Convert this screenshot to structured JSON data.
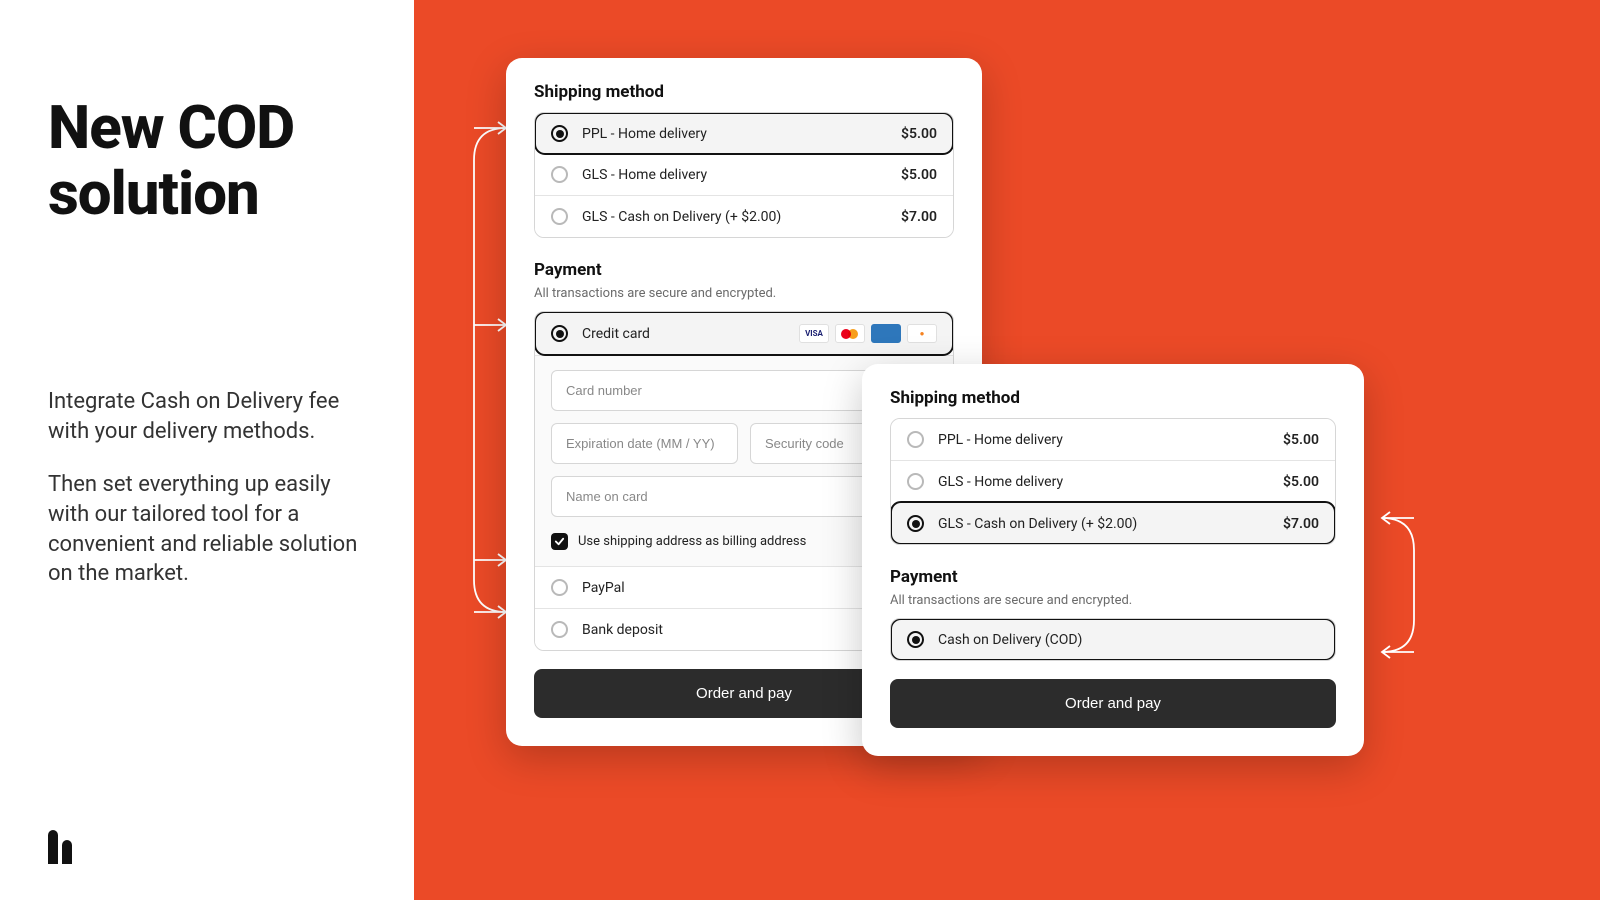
{
  "left": {
    "headline": "New COD solution",
    "p1": "Integrate Cash on Delivery fee with your delivery methods.",
    "p2": "Then set everything up easily with our tailored tool for a convenient and reliable solution on the market."
  },
  "card_big": {
    "shipping_title": "Shipping method",
    "shipping_options": [
      {
        "label": "PPL - Home delivery",
        "price": "$5.00",
        "selected": true
      },
      {
        "label": "GLS - Home delivery",
        "price": "$5.00",
        "selected": false
      },
      {
        "label": "GLS - Cash on Delivery (+ $2.00)",
        "price": "$7.00",
        "selected": false
      }
    ],
    "payment_title": "Payment",
    "payment_sub": "All transactions are secure and encrypted.",
    "cc_label": "Credit card",
    "cc_fields": {
      "card_number": "Card number",
      "exp": "Expiration date (MM / YY)",
      "cvc": "Security code",
      "name": "Name on card"
    },
    "billing_checkbox_label": "Use shipping address as billing address",
    "paypal_label": "PayPal",
    "bank_label": "Bank deposit",
    "cta": "Order and pay"
  },
  "card_small": {
    "shipping_title": "Shipping method",
    "shipping_options": [
      {
        "label": "PPL - Home delivery",
        "price": "$5.00",
        "selected": false
      },
      {
        "label": "GLS - Home delivery",
        "price": "$5.00",
        "selected": false
      },
      {
        "label": "GLS - Cash on Delivery (+ $2.00)",
        "price": "$7.00",
        "selected": true
      }
    ],
    "payment_title": "Payment",
    "payment_sub": "All transactions are secure and encrypted.",
    "cod_label": "Cash on Delivery (COD)",
    "cta": "Order and pay"
  }
}
